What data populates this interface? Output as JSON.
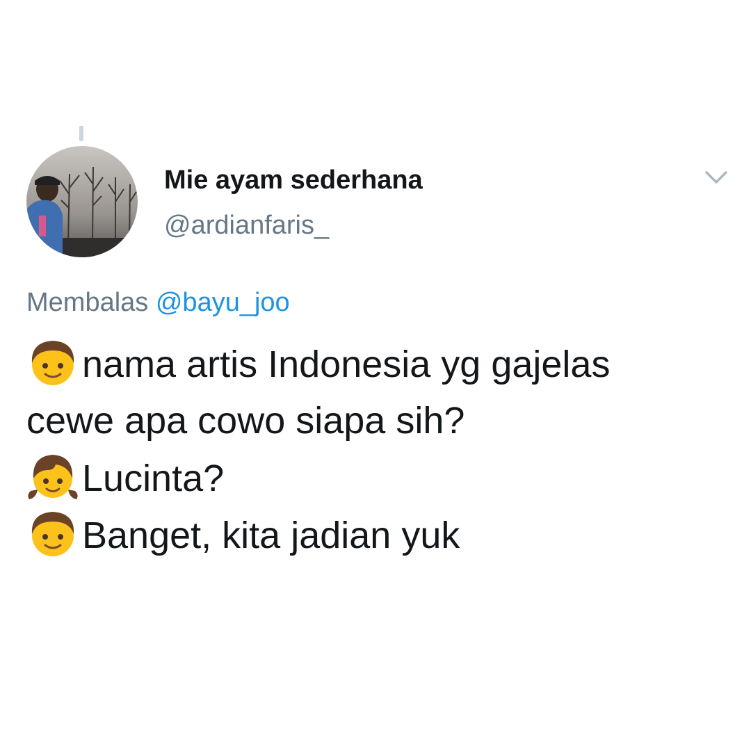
{
  "tweet": {
    "author": {
      "display_name": "Mie ayam sederhana",
      "handle": "@ardianfaris_",
      "avatar_icon": "profile-photo-avatar"
    },
    "menu_icon": "chevron-down-icon",
    "reply": {
      "prefix": "Membalas",
      "mention": "@bayu_joo"
    },
    "lines": [
      {
        "emoji": "boy-emoji",
        "text": "nama artis Indonesia yg gajelas"
      },
      {
        "emoji": "",
        "text": "cewe apa cowo siapa sih?"
      },
      {
        "emoji": "girl-emoji",
        "text": "Lucinta?"
      },
      {
        "emoji": "boy-emoji",
        "text": "Banget,  kita jadian yuk"
      }
    ]
  },
  "colors": {
    "text_primary": "#14171a",
    "text_secondary": "#657786",
    "link": "#1b95e0",
    "thread_line": "#ccd6dd"
  }
}
